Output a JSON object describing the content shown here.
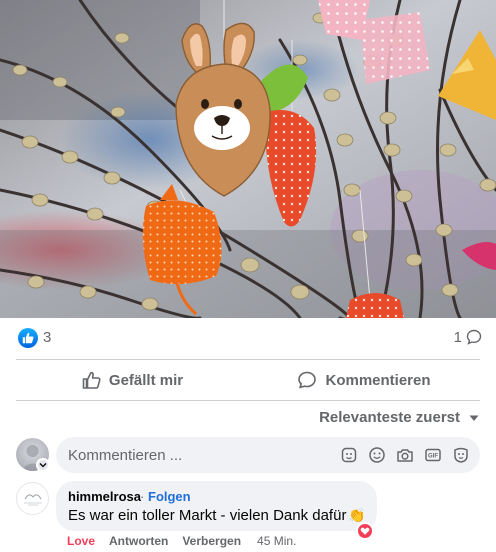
{
  "post": {
    "reaction_count": "3",
    "comment_count": "1"
  },
  "actions": {
    "like_label": "Gefällt mir",
    "comment_label": "Kommentieren"
  },
  "sort": {
    "label": "Relevanteste zuerst"
  },
  "composer": {
    "placeholder": "Kommentieren ..."
  },
  "comment": {
    "author": "himmelrosa",
    "separator": "·",
    "follow_label": "Folgen",
    "text": "Es war ein toller Markt - vielen Dank dafür",
    "emoji": "👏",
    "reaction_label": "Love",
    "reply_label": "Antworten",
    "edit_label": "Verbergen",
    "time": "45 Min."
  },
  "icons": {
    "reaction": "like-icon",
    "comment_reaction": "heart-icon",
    "composer": [
      "sticker-icon",
      "emoji-icon",
      "camera-icon",
      "gif-icon",
      "avatar-sticker-icon"
    ]
  },
  "colors": {
    "like_blue": "#0866ff",
    "love_red": "#f33e58",
    "follow_blue": "#216fdb",
    "muted_text": "#65676b",
    "bubble_bg": "#f0f2f5"
  }
}
